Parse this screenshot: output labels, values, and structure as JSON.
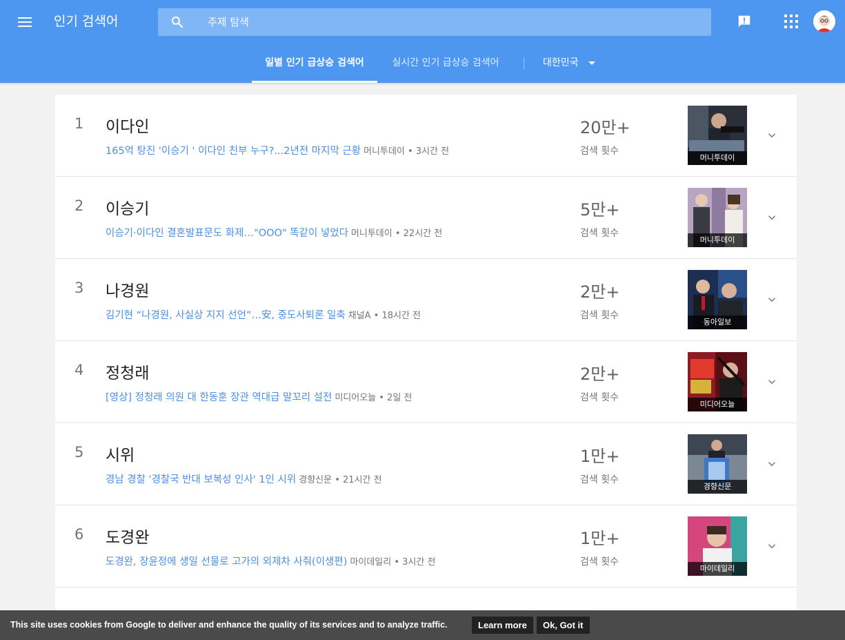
{
  "header": {
    "title": "인기 검색어",
    "search_placeholder": "주제 탐색"
  },
  "tabs": [
    {
      "label": "일별 인기 급상승 검색어"
    },
    {
      "label": "실시간 인기 급상승 검색어"
    }
  ],
  "country": "대한민국",
  "count_label": "검색 횟수",
  "trends": [
    {
      "rank": "1",
      "term": "이다인",
      "story": "165억 탕진 '이승기 ' 이다인 친부 누구?...2년전 마지막 근황",
      "meta": "머니투데이 • 3시간 전",
      "count": "20만+",
      "thumb_source": "머니투데이"
    },
    {
      "rank": "2",
      "term": "이승기",
      "story": "이승기·이다인 결혼발표문도 화제…\"OOO\" 똑같이 넣었다",
      "meta": "머니투데이 • 22시간 전",
      "count": "5만+",
      "thumb_source": "머니투데이"
    },
    {
      "rank": "3",
      "term": "나경원",
      "story": "김기현 “나경원, 사실상 지지 선언”…安, 중도사퇴론 일축",
      "meta": "채널A • 18시간 전",
      "count": "2만+",
      "thumb_source": "동아일보"
    },
    {
      "rank": "4",
      "term": "정청래",
      "story": "[영상] 정청래 의원 대 한동훈 장관 역대급 말꼬리 설전",
      "meta": "미디어오늘 • 2일 전",
      "count": "2만+",
      "thumb_source": "미디어오늘"
    },
    {
      "rank": "5",
      "term": "시위",
      "story": "경남 경찰 '경찰국 반대 보복성 인사' 1인 시위",
      "meta": "경향신문 • 21시간 전",
      "count": "1만+",
      "thumb_source": "경향신문"
    },
    {
      "rank": "6",
      "term": "도경완",
      "story": "도경완, 장윤정에 생일 선물로 고가의 외제차 사줘(이생편)",
      "meta": "마이데일리 • 3시간 전",
      "count": "1만+",
      "thumb_source": "마이데일리"
    }
  ],
  "cookie": {
    "text": "This site uses cookies from Google to deliver and enhance the quality of its services and to analyze traffic.",
    "learn_more": "Learn more",
    "ok": "Ok, Got it"
  }
}
